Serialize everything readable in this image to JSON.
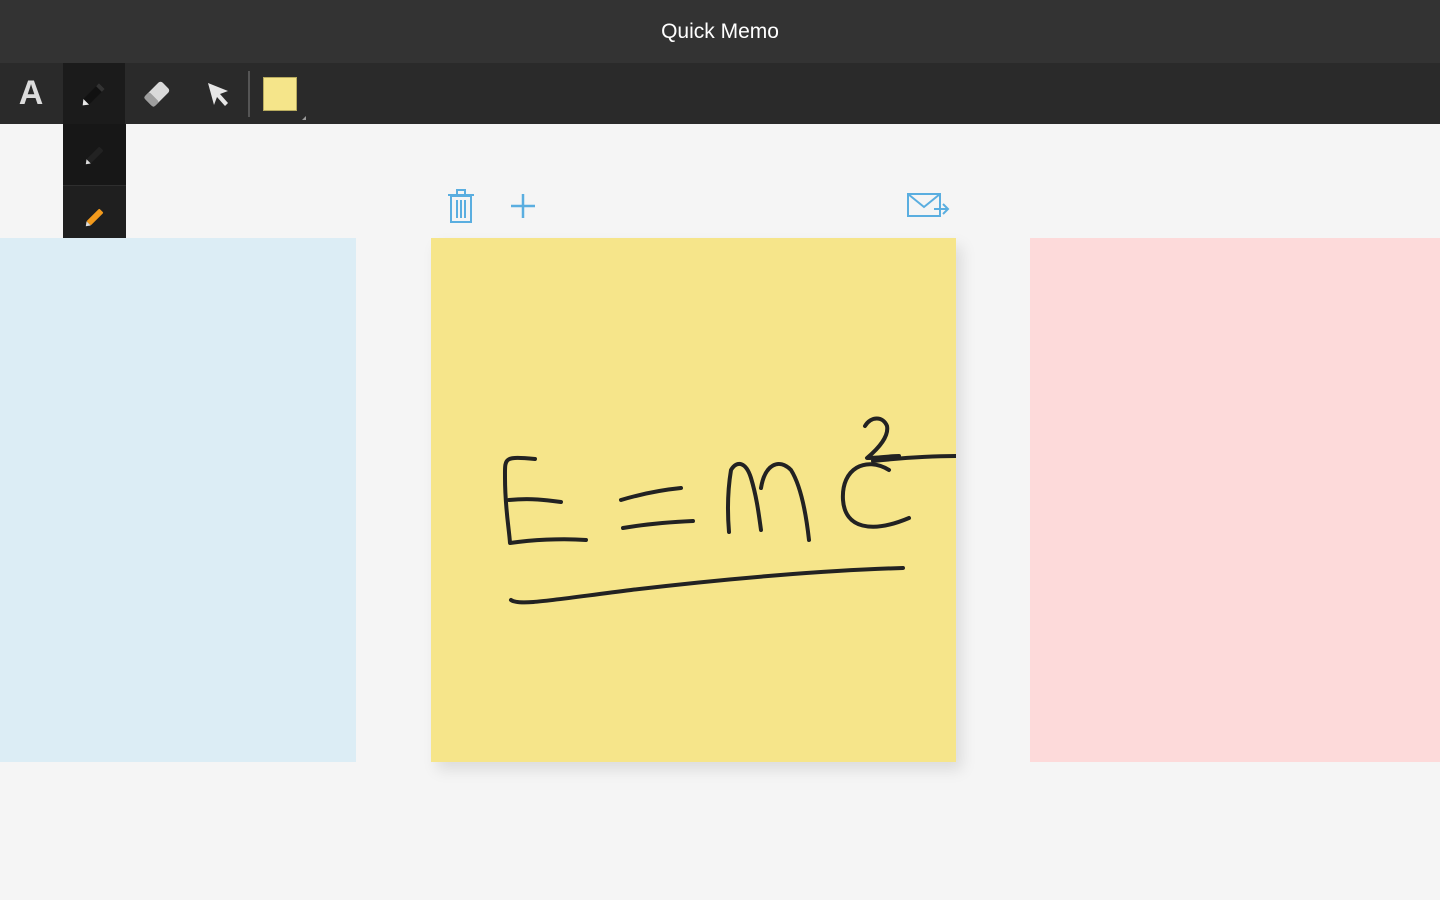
{
  "app": {
    "title": "Quick Memo"
  },
  "toolbar": {
    "text_tool_glyph": "A",
    "tools": {
      "text": "text-tool",
      "pen": "pen-icon",
      "eraser": "eraser-icon",
      "select": "cursor-arrow-icon",
      "background_color": "#f6e58a"
    },
    "active_tool": "pen"
  },
  "pen_palette": {
    "selected_index": 0,
    "colors": [
      "#222222",
      "#f29a1c",
      "#6fc46b",
      "#f2f2f2",
      "#1b1b7a",
      "#8e2aa8"
    ]
  },
  "notes": [
    {
      "position": "left",
      "color": "#dcedf5"
    },
    {
      "position": "center",
      "color": "#f6e58a",
      "handwriting": "E=mc²"
    },
    {
      "position": "right",
      "color": "#fddada"
    }
  ],
  "note_actions": {
    "delete": "trash-icon",
    "add": "plus-icon",
    "share": "mail-send-icon",
    "accent": "#5aaee0"
  }
}
